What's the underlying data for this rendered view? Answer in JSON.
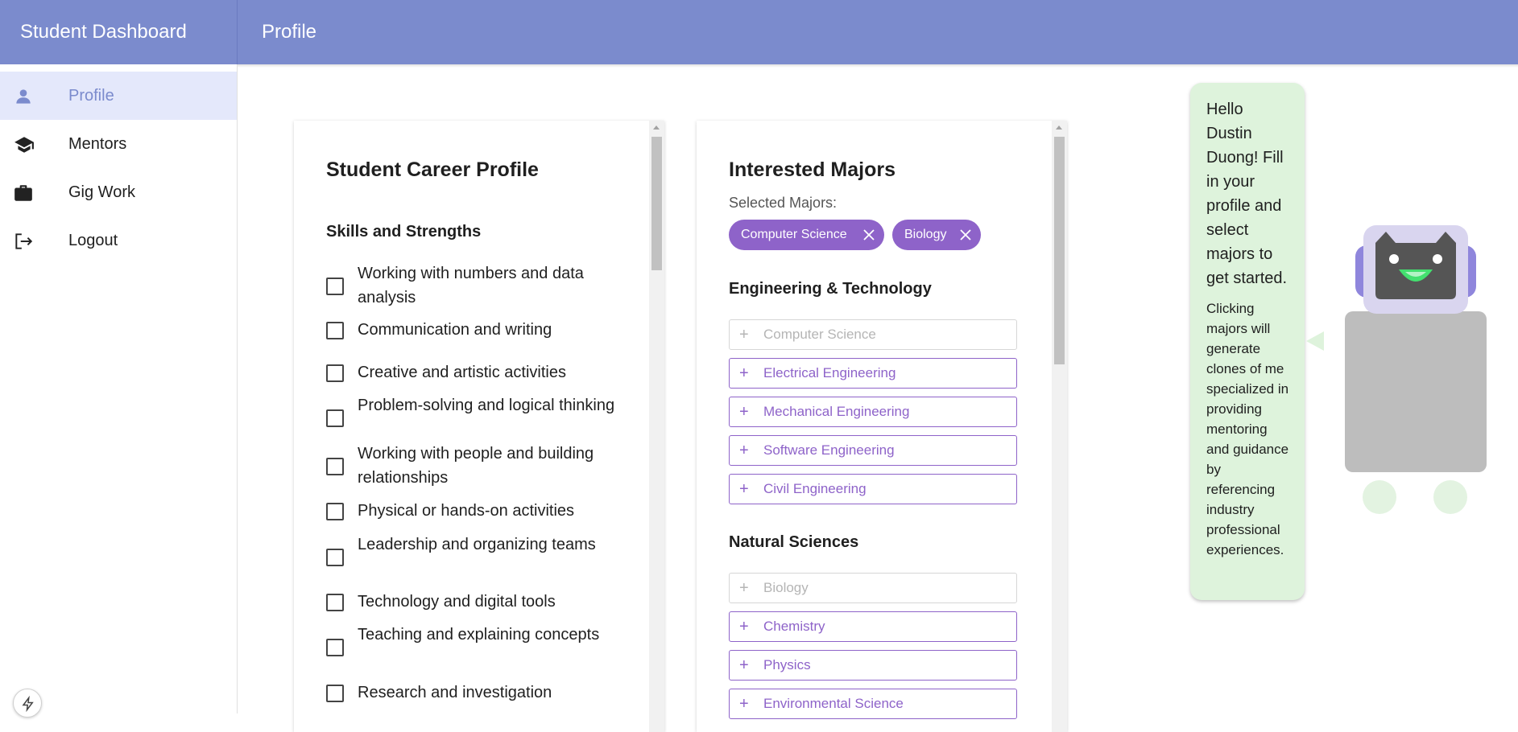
{
  "app": {
    "title": "Student Dashboard"
  },
  "header": {
    "page_title": "Profile"
  },
  "sidebar": {
    "items": [
      {
        "label": "Profile",
        "icon": "person-icon",
        "active": true
      },
      {
        "label": "Mentors",
        "icon": "graduation-cap-icon",
        "active": false
      },
      {
        "label": "Gig Work",
        "icon": "briefcase-icon",
        "active": false
      },
      {
        "label": "Logout",
        "icon": "logout-icon",
        "active": false
      }
    ]
  },
  "career_profile": {
    "title": "Student Career Profile",
    "skills_heading": "Skills and Strengths",
    "skills": [
      "Working with numbers and data analysis",
      "Communication and writing",
      "Creative and artistic activities",
      "Problem-solving and logical thinking",
      "Working with people and building relationships",
      "Physical or hands-on activities",
      "Leadership and organizing teams",
      "Technology and digital tools",
      "Teaching and explaining concepts",
      "Research and investigation"
    ]
  },
  "majors": {
    "title": "Interested Majors",
    "selected_label": "Selected Majors:",
    "selected": [
      "Computer Science",
      "Biology"
    ],
    "groups": [
      {
        "heading": "Engineering & Technology",
        "items": [
          {
            "label": "Computer Science",
            "disabled": true
          },
          {
            "label": "Electrical Engineering",
            "disabled": false
          },
          {
            "label": "Mechanical Engineering",
            "disabled": false
          },
          {
            "label": "Software Engineering",
            "disabled": false
          },
          {
            "label": "Civil Engineering",
            "disabled": false
          }
        ]
      },
      {
        "heading": "Natural Sciences",
        "items": [
          {
            "label": "Biology",
            "disabled": true
          },
          {
            "label": "Chemistry",
            "disabled": false
          },
          {
            "label": "Physics",
            "disabled": false
          },
          {
            "label": "Environmental Science",
            "disabled": false
          }
        ]
      }
    ]
  },
  "assistant": {
    "greeting": "Hello Dustin Duong! Fill in your profile and select majors to get started.",
    "hint": "Clicking majors will generate clones of me specialized in providing mentoring and guidance by referencing industry professional experiences."
  },
  "colors": {
    "header": "#7b8bcd",
    "accent": "#8e63c9",
    "active_nav_bg": "#e4e8fb",
    "bubble": "#def3dc"
  }
}
